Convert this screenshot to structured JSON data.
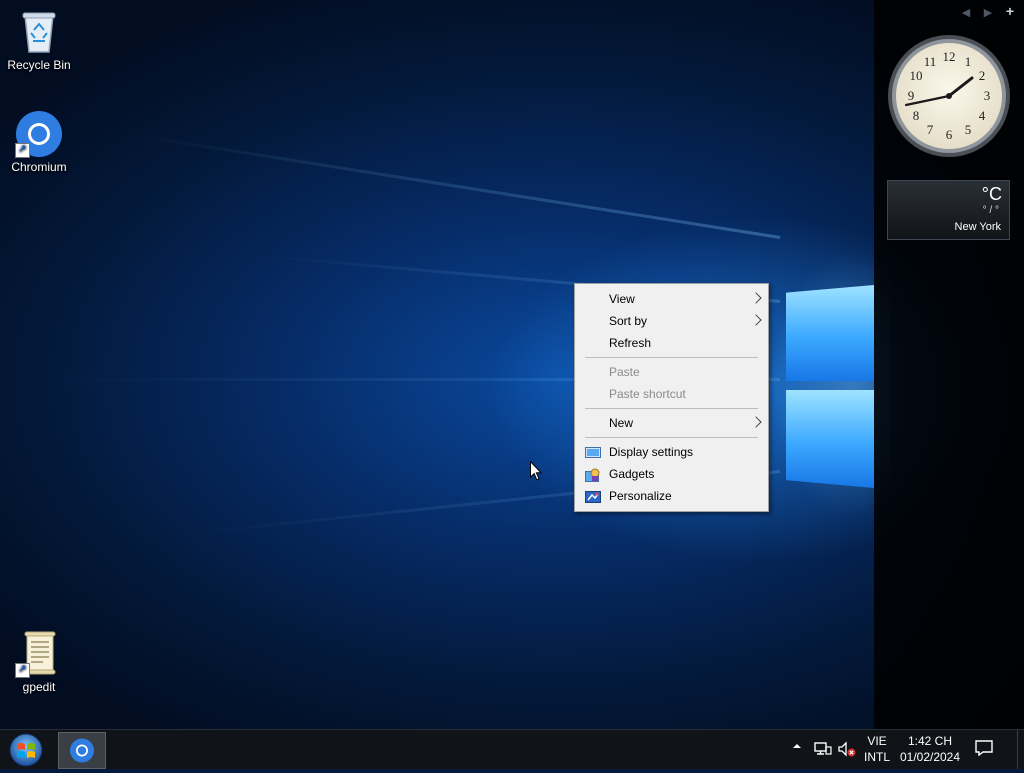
{
  "desktop": {
    "icons": [
      {
        "label": "Recycle Bin",
        "icon": "recycle-bin-icon"
      },
      {
        "label": "Chromium",
        "icon": "chromium-icon"
      },
      {
        "label": "gpedit",
        "icon": "document-icon"
      }
    ]
  },
  "sidebar": {
    "controls": {
      "prev": "◀",
      "next": "▶",
      "add": "+"
    },
    "weather": {
      "temp": "°C",
      "range": "° / °",
      "city": "New York"
    }
  },
  "context_menu": {
    "items": [
      {
        "label": "View",
        "enabled": true,
        "submenu": true
      },
      {
        "label": "Sort by",
        "enabled": true,
        "submenu": true
      },
      {
        "label": "Refresh",
        "enabled": true
      },
      {
        "label": "Paste",
        "enabled": false
      },
      {
        "label": "Paste shortcut",
        "enabled": false
      },
      {
        "label": "New",
        "enabled": true,
        "submenu": true
      },
      {
        "label": "Display settings",
        "enabled": true,
        "icon": "display-settings-icon"
      },
      {
        "label": "Gadgets",
        "enabled": true,
        "icon": "gadgets-icon"
      },
      {
        "label": "Personalize",
        "enabled": true,
        "icon": "personalize-icon"
      }
    ]
  },
  "taskbar": {
    "start_icon": "windows-start-icon",
    "pinned": [
      {
        "name": "Chromium",
        "icon": "chromium-icon"
      }
    ],
    "tray": {
      "language_line1": "VIE",
      "language_line2": "INTL",
      "time": "1:42 CH",
      "date": "01/02/2024"
    }
  },
  "colors": {
    "wallpaper_accent": "#1877e6",
    "menu_bg": "#f0f0f0",
    "taskbar_bg": "#101317"
  }
}
